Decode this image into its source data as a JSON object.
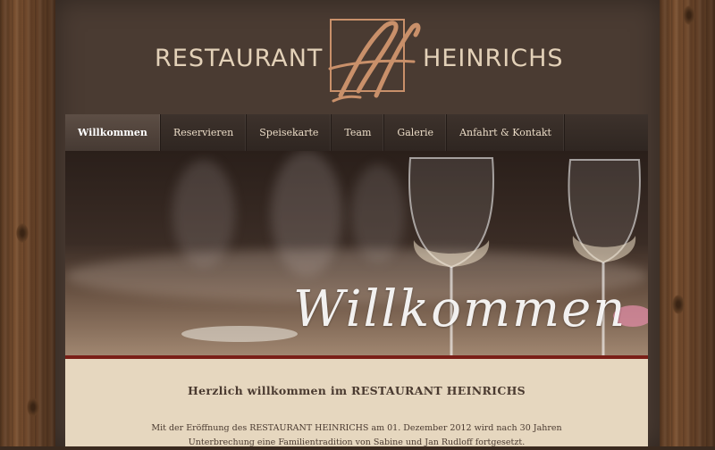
{
  "brand": {
    "left_text": "RESTAURANT",
    "right_text": "HEINRICHS",
    "monogram": "H"
  },
  "nav": {
    "items": [
      {
        "label": "Willkommen",
        "active": true
      },
      {
        "label": "Reservieren",
        "active": false
      },
      {
        "label": "Speisekarte",
        "active": false
      },
      {
        "label": "Team",
        "active": false
      },
      {
        "label": "Galerie",
        "active": false
      },
      {
        "label": "Anfahrt & Kontakt",
        "active": false
      }
    ]
  },
  "hero": {
    "script_text": "Willkommen"
  },
  "content": {
    "heading": "Herzlich willkommen im RESTAURANT HEINRICHS",
    "body_line1": "Mit der Eröffnung des RESTAURANT HEINRICHS am 01. Dezember 2012 wird nach 30 Jahren",
    "body_line2": "Unterbrechung eine Familientradition von Sabine und Jan Rudloff fortgesetzt."
  },
  "colors": {
    "page_bg": "#4a3b32",
    "logo_text": "#e3d1b8",
    "monogram_accent": "#c9906a",
    "hero_bar": "#7a1f17",
    "content_bg": "#e6d7bf"
  }
}
